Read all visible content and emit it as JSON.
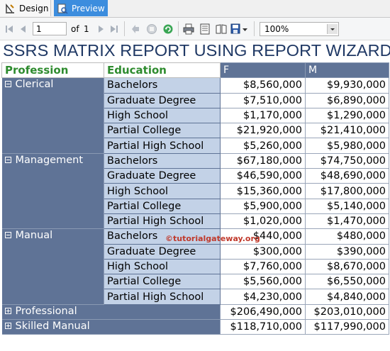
{
  "tabs": [
    {
      "label": "Design",
      "icon": "design-icon"
    },
    {
      "label": "Preview",
      "icon": "preview-icon"
    }
  ],
  "toolbar": {
    "page_value": "1",
    "of_label": "of",
    "total_pages": "1",
    "zoom": "100%"
  },
  "report": {
    "title": "SSRS MATRIX REPORT USING REPORT WIZARD",
    "header": {
      "profession": "Profession",
      "education": "Education",
      "col_f": "F",
      "col_m": "M"
    },
    "groups": [
      {
        "name": "Clerical",
        "expanded": true,
        "rows": [
          {
            "education": "Bachelors",
            "f": "$8,560,000",
            "m": "$9,930,000"
          },
          {
            "education": "Graduate Degree",
            "f": "$7,510,000",
            "m": "$6,890,000"
          },
          {
            "education": "High School",
            "f": "$1,170,000",
            "m": "$1,290,000"
          },
          {
            "education": "Partial College",
            "f": "$21,920,000",
            "m": "$21,410,000"
          },
          {
            "education": "Partial High School",
            "f": "$5,260,000",
            "m": "$5,980,000"
          }
        ]
      },
      {
        "name": "Management",
        "expanded": true,
        "rows": [
          {
            "education": "Bachelors",
            "f": "$67,180,000",
            "m": "$74,750,000"
          },
          {
            "education": "Graduate Degree",
            "f": "$46,590,000",
            "m": "$48,690,000"
          },
          {
            "education": "High School",
            "f": "$15,360,000",
            "m": "$17,800,000"
          },
          {
            "education": "Partial College",
            "f": "$5,900,000",
            "m": "$5,140,000"
          },
          {
            "education": "Partial High School",
            "f": "$1,020,000",
            "m": "$1,470,000"
          }
        ]
      },
      {
        "name": "Manual",
        "expanded": true,
        "rows": [
          {
            "education": "Bachelors",
            "f": "$440,000",
            "m": "$480,000"
          },
          {
            "education": "Graduate Degree",
            "f": "$300,000",
            "m": "$390,000"
          },
          {
            "education": "High School",
            "f": "$7,760,000",
            "m": "$8,670,000"
          },
          {
            "education": "Partial College",
            "f": "$5,560,000",
            "m": "$6,550,000"
          },
          {
            "education": "Partial High School",
            "f": "$4,230,000",
            "m": "$4,840,000"
          }
        ]
      },
      {
        "name": "Professional",
        "expanded": false,
        "f": "$206,490,000",
        "m": "$203,010,000"
      },
      {
        "name": "Skilled Manual",
        "expanded": false,
        "f": "$118,710,000",
        "m": "$117,990,000"
      }
    ],
    "watermark": "©tutorialgateway.org"
  },
  "colors": {
    "group_bg": "#5f7396",
    "edu_bg": "#c3d2e7",
    "title": "#1f3864",
    "header_green": "#2e8b2e",
    "tab_active": "#3c8dde"
  }
}
